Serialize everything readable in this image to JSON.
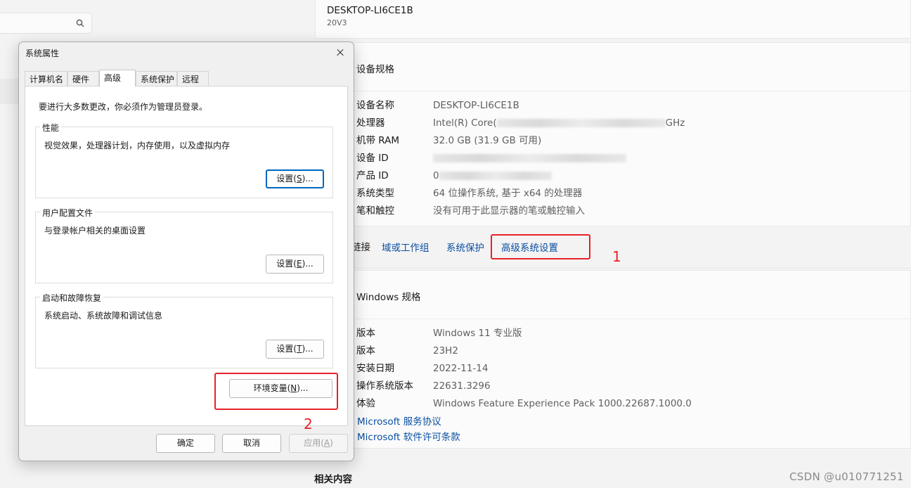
{
  "settings": {
    "device_name": "DESKTOP-LI6CE1B",
    "device_model": "20V3",
    "device_specs": {
      "heading": "设备规格",
      "rows": [
        {
          "key": "设备名称",
          "value": "DESKTOP-LI6CE1B"
        },
        {
          "key": "处理器",
          "value": "Intel(R) Core(",
          "value_tail": "GHz"
        },
        {
          "key": "机带 RAM",
          "value": "32.0 GB (31.9 GB 可用)"
        },
        {
          "key": "设备 ID",
          "value": ""
        },
        {
          "key": "产品 ID",
          "value": "0"
        },
        {
          "key": "系统类型",
          "value": "64 位操作系统, 基于 x64 的处理器"
        },
        {
          "key": "笔和触控",
          "value": "没有可用于此显示器的笔或触控输入"
        }
      ]
    },
    "related_links": {
      "label": "链接",
      "items": [
        "域或工作组",
        "系统保护",
        "高级系统设置"
      ]
    },
    "windows_specs": {
      "heading": "Windows 规格",
      "rows": [
        {
          "key": "版本",
          "value": "Windows 11 专业版"
        },
        {
          "key": "版本",
          "value": "23H2"
        },
        {
          "key": "安装日期",
          "value": "2022-11-14"
        },
        {
          "key": "操作系统版本",
          "value": "22631.3296"
        },
        {
          "key": "体验",
          "value": "Windows Feature Experience Pack 1000.22687.1000.0"
        }
      ],
      "links": [
        "Microsoft 服务协议",
        "Microsoft 软件许可条款"
      ]
    },
    "related_content": "相关内容",
    "watermark": "CSDN @u010771251"
  },
  "dialog": {
    "title": "系统属性",
    "tabs": [
      "计算机名",
      "硬件",
      "高级",
      "系统保护",
      "远程"
    ],
    "active_tab": "高级",
    "admin_note": "要进行大多数更改，你必须作为管理员登录。",
    "groups": [
      {
        "title": "性能",
        "desc": "视觉效果，处理器计划，内存使用，以及虚拟内存",
        "button": "设置",
        "accel": "S"
      },
      {
        "title": "用户配置文件",
        "desc": "与登录帐户相关的桌面设置",
        "button": "设置",
        "accel": "E"
      },
      {
        "title": "启动和故障恢复",
        "desc": "系统启动、系统故障和调试信息",
        "button": "设置",
        "accel": "T"
      }
    ],
    "env_button": {
      "label": "环境变量",
      "accel": "N"
    },
    "ok": "确定",
    "cancel": "取消",
    "apply": {
      "label": "应用",
      "accel": "A"
    }
  },
  "annotations": [
    "1",
    "2"
  ],
  "colors": {
    "annotation": "#e8202a",
    "link": "#0a4fa3",
    "focus": "#0067c0"
  }
}
